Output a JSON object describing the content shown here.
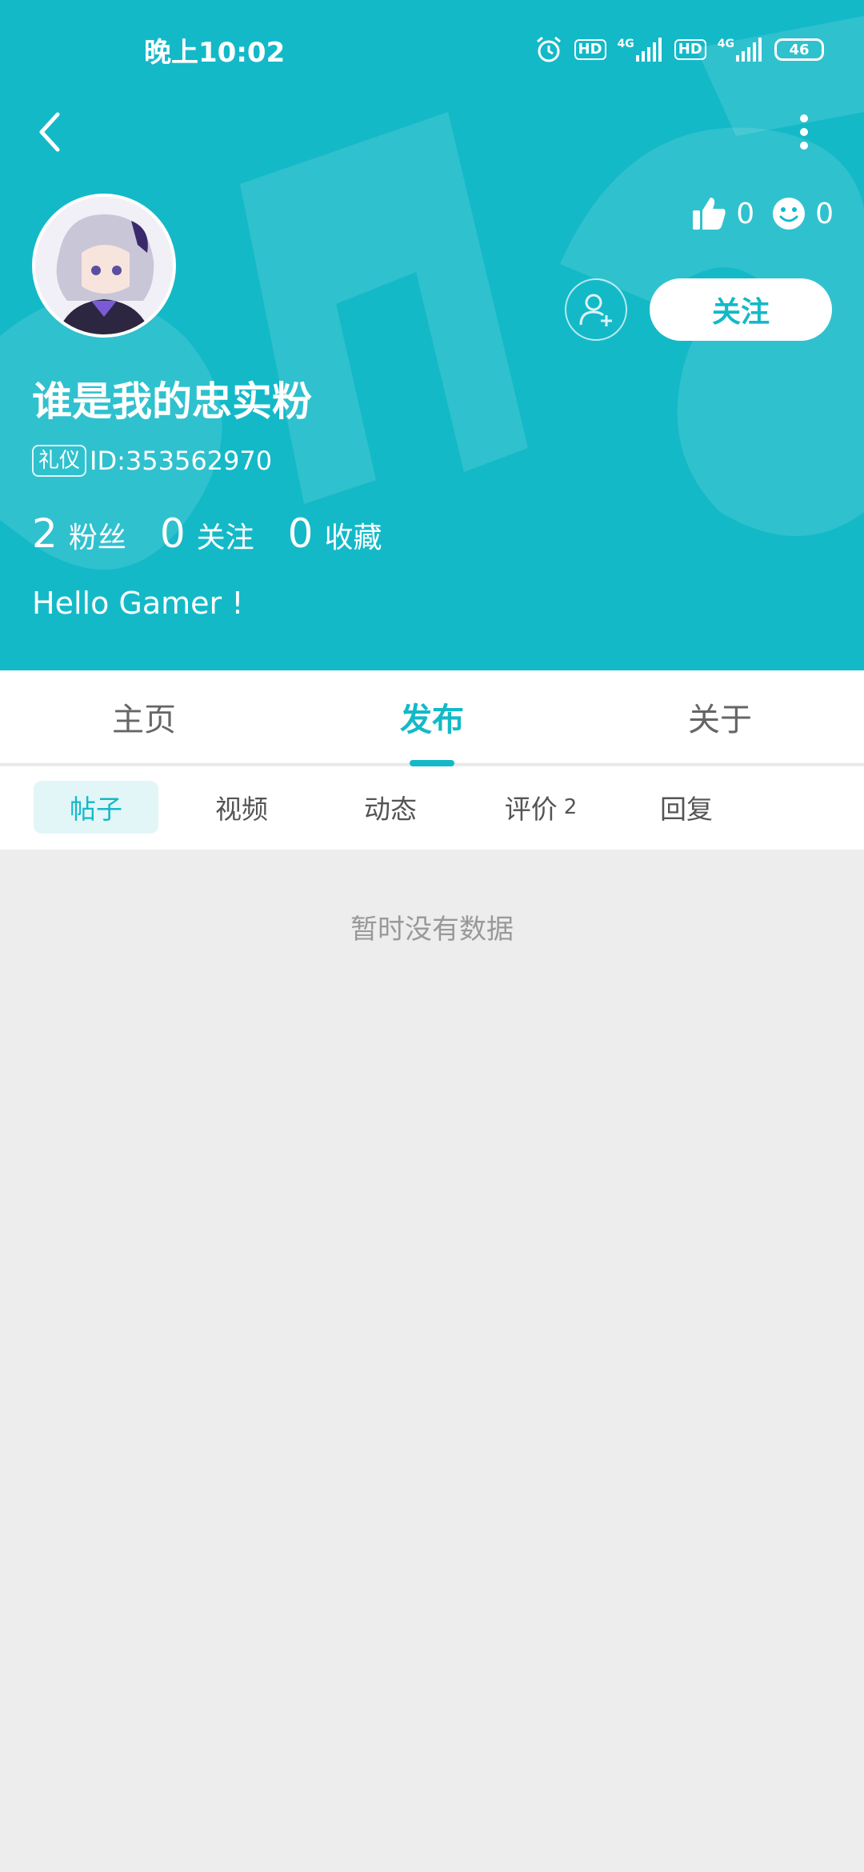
{
  "status": {
    "time": "晚上10:02",
    "hd1": "HD",
    "net1": "4G",
    "hd2": "HD",
    "net2": "4G",
    "battery": "46"
  },
  "profile": {
    "username": "谁是我的忠实粉",
    "badge": "礼仪",
    "id_text": "ID:353562970",
    "bio": "Hello Gamer !",
    "likes": "0",
    "smiles": "0",
    "follow_label": "关注",
    "counts": [
      {
        "num": "2",
        "label": "粉丝"
      },
      {
        "num": "0",
        "label": "关注"
      },
      {
        "num": "0",
        "label": "收藏"
      }
    ]
  },
  "tabs": [
    {
      "label": "主页"
    },
    {
      "label": "发布"
    },
    {
      "label": "关于"
    }
  ],
  "subtabs": [
    {
      "label": "帖子",
      "count": ""
    },
    {
      "label": "视频",
      "count": ""
    },
    {
      "label": "动态",
      "count": ""
    },
    {
      "label": "评价",
      "count": "2"
    },
    {
      "label": "回复",
      "count": ""
    }
  ],
  "content": {
    "empty_text": "暂时没有数据"
  },
  "colors": {
    "accent": "#14b9c8",
    "background": "#ededed"
  }
}
